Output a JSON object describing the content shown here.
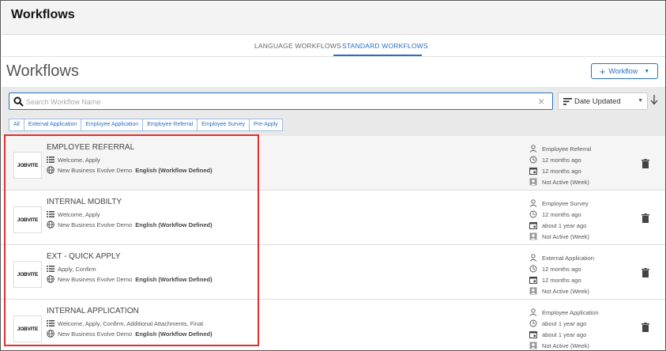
{
  "header": {
    "title": "Workflows"
  },
  "tabs": [
    {
      "label": "LANGUAGE WORKFLOWS",
      "active": false
    },
    {
      "label": "STANDARD WORKFLOWS",
      "active": true
    }
  ],
  "page": {
    "title": "Workflows",
    "add_button_label": "Workflow"
  },
  "search": {
    "placeholder": "Search Workflow Name",
    "value": ""
  },
  "sort": {
    "selected": "Date Updated",
    "direction": "descending"
  },
  "filters": [
    "All",
    "External Application",
    "Employee Application",
    "Employee Referral",
    "Employee Survey",
    "Pre-Apply"
  ],
  "colors": {
    "accent": "#2a6fc4",
    "highlight": "#e03030"
  },
  "workflows": [
    {
      "logo": "JOBVITE",
      "name": "EMPLOYEE REFERRAL",
      "steps": "Welcome, Apply",
      "org": "New Business Evolve Demo",
      "language": "English (Workflow Defined)",
      "type": "Employee Referral",
      "created": "12 months ago",
      "updated": "12 months ago",
      "activity": "Not Active (Week)"
    },
    {
      "logo": "JOBVITE",
      "name": "INTERNAL MOBILTY",
      "steps": "Welcome, Apply",
      "org": "New Business Evolve Demo",
      "language": "English (Workflow Defined)",
      "type": "Employee Survey",
      "created": "12 months ago",
      "updated": "about 1 year ago",
      "activity": "Not Active (Week)"
    },
    {
      "logo": "JOBVITE",
      "name": "EXT - QUICK APPLY",
      "steps": "Apply, Confirm",
      "org": "New Business Evolve Demo",
      "language": "English (Workflow Defined)",
      "type": "External Application",
      "created": "12 months ago",
      "updated": "12 months ago",
      "activity": "Not Active (Week)"
    },
    {
      "logo": "JOBVITE",
      "name": "INTERNAL APPLICATION",
      "steps": "Welcome, Apply, Confirm, Additional Attachments, Final",
      "org": "New Business Evolve Demo",
      "language": "English (Workflow Defined)",
      "type": "Employee Application",
      "created": "about 1 year ago",
      "updated": "about 1 year ago",
      "activity": "Not Active (Week)"
    }
  ]
}
